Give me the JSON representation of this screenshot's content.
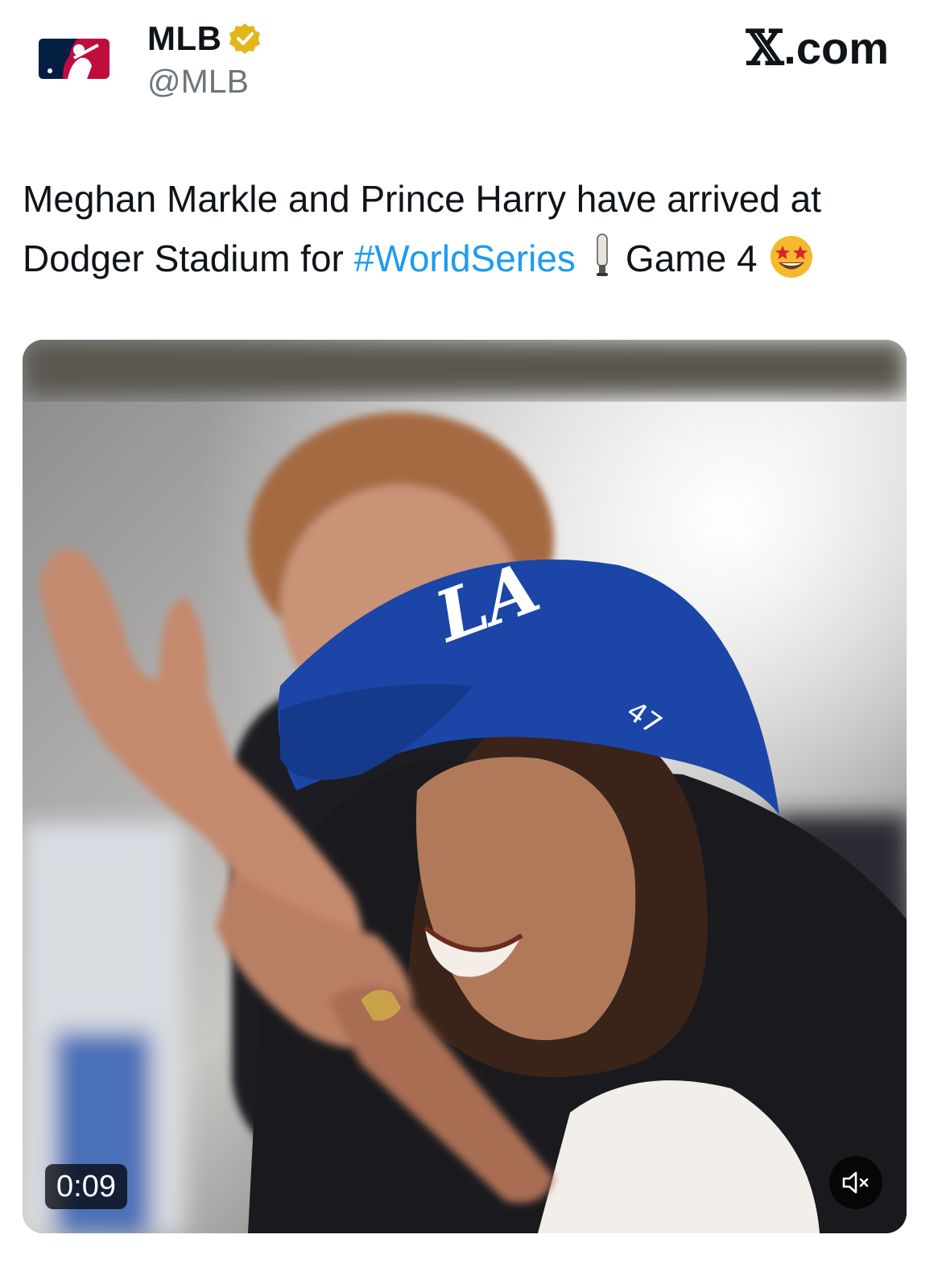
{
  "account": {
    "display_name": "MLB",
    "handle": "@MLB",
    "verified": true,
    "avatar_icon": "mlb-logo"
  },
  "brand": {
    "site": ".com",
    "logo_icon": "x-logo"
  },
  "tweet": {
    "text_before": "Meghan Markle and Prince Harry have arrived at Dodger Stadium for ",
    "hashtag": "#WorldSeries",
    "text_after": "Game 4",
    "emojis": [
      "baseball-bat",
      "star-struck"
    ]
  },
  "video": {
    "duration": "0:09",
    "muted": true,
    "mute_icon": "speaker-muted-icon"
  },
  "colors": {
    "hashtag": "#1d9bf0",
    "handle": "#6e767d",
    "verified_badge": "#e2b719",
    "mlb_blue": "#041e42",
    "mlb_red": "#bf0d3e"
  }
}
